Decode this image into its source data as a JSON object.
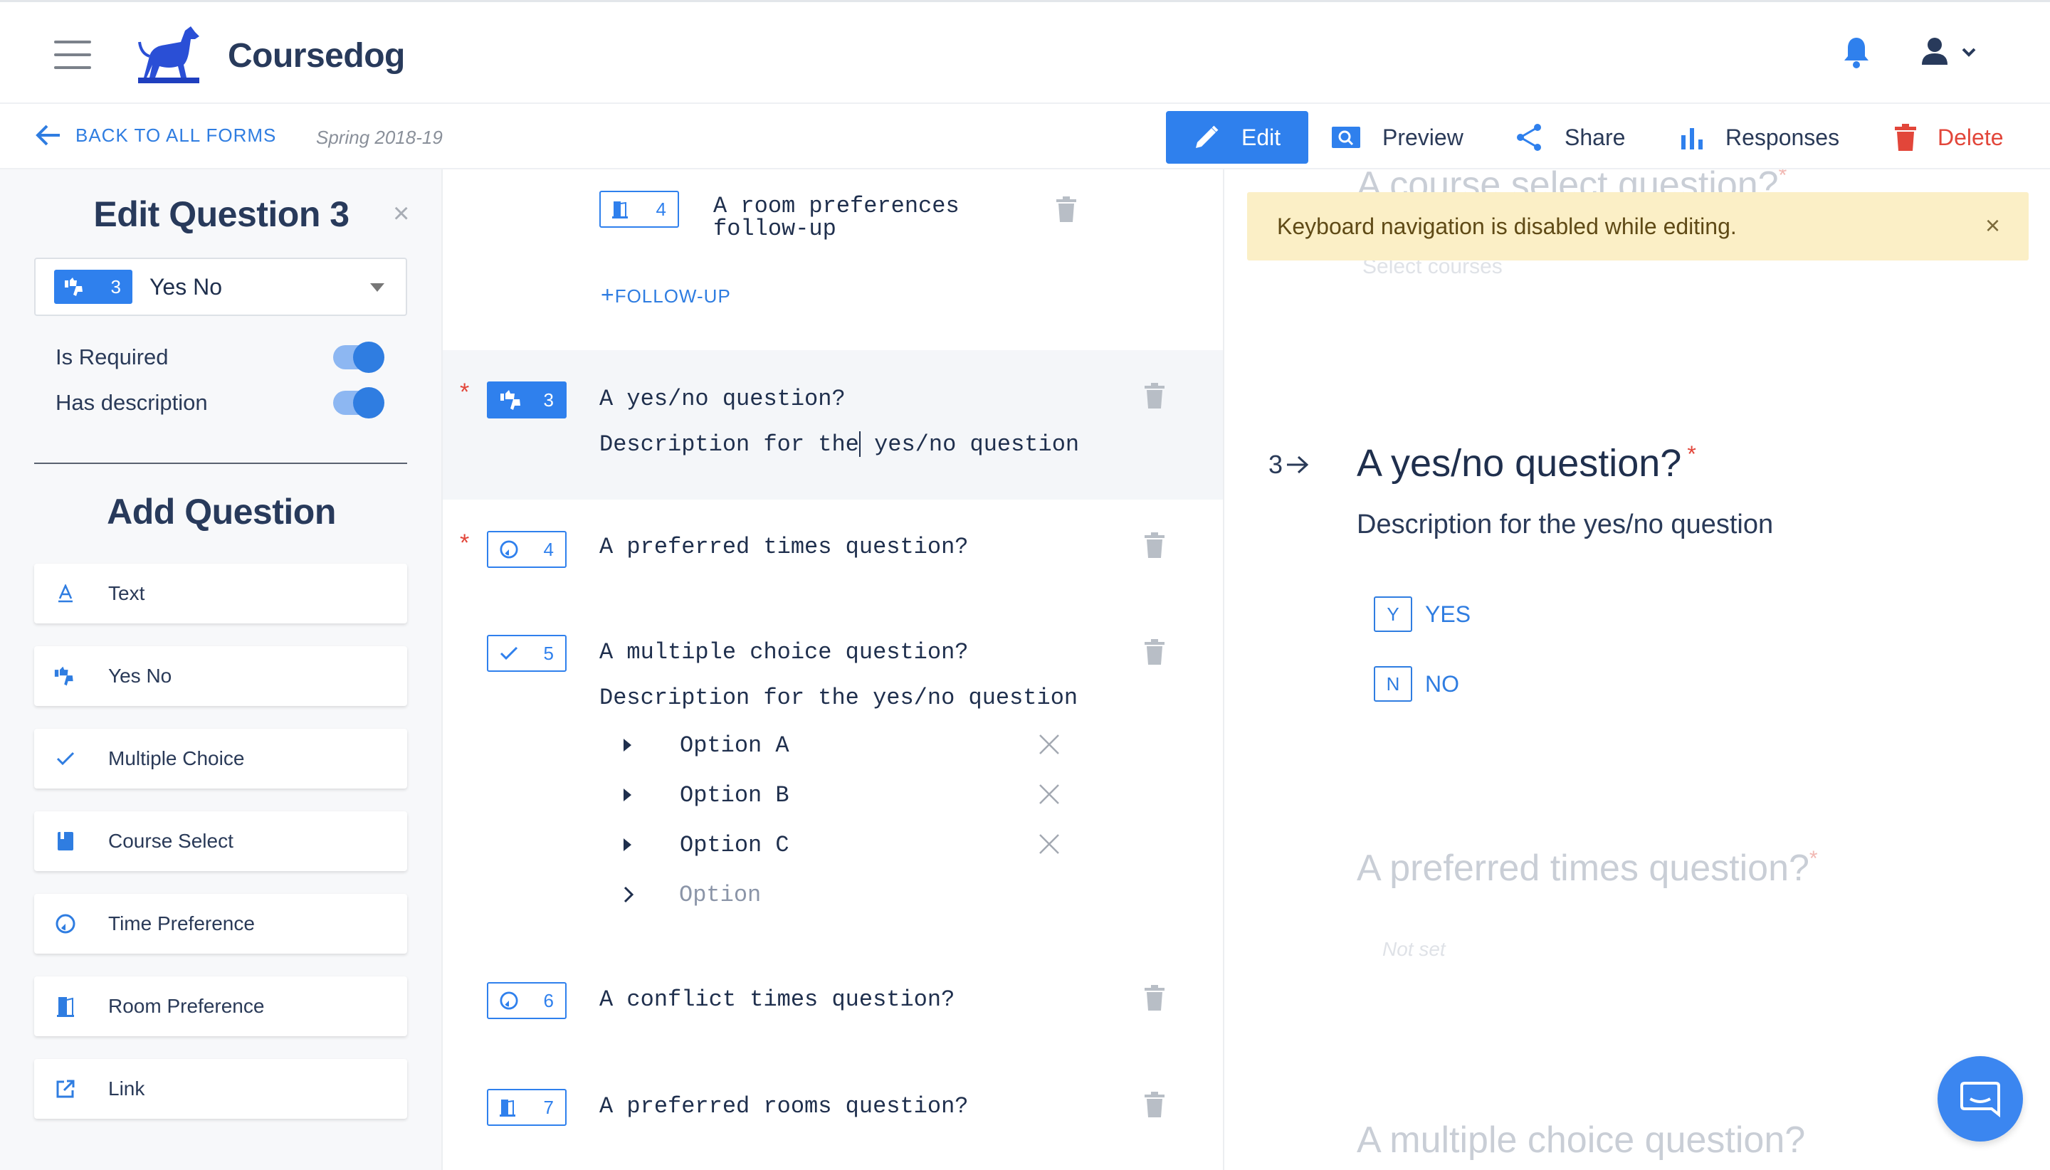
{
  "app": {
    "brand": "Coursedog"
  },
  "subbar": {
    "back_label": "BACK TO ALL FORMS",
    "term": "Spring 2018-19",
    "actions": {
      "edit": "Edit",
      "preview": "Preview",
      "share": "Share",
      "responses": "Responses",
      "delete": "Delete"
    }
  },
  "sidebar": {
    "edit_title": "Edit Question 3",
    "close_glyph": "×",
    "selected_type": {
      "number": "3",
      "label": "Yes No",
      "icon": "thumbs-icon"
    },
    "toggles": [
      {
        "label": "Is Required",
        "on": true
      },
      {
        "label": "Has description",
        "on": true
      }
    ],
    "add_title": "Add Question",
    "add_items": [
      {
        "label": "Text",
        "icon": "text-icon"
      },
      {
        "label": "Yes No",
        "icon": "thumbs-icon"
      },
      {
        "label": "Multiple Choice",
        "icon": "check-icon"
      },
      {
        "label": "Course Select",
        "icon": "book-icon"
      },
      {
        "label": "Time Preference",
        "icon": "clock-icon"
      },
      {
        "label": "Room Preference",
        "icon": "door-icon"
      },
      {
        "label": "Link",
        "icon": "external-link-icon"
      }
    ]
  },
  "questions": {
    "followup_q": {
      "number": "4",
      "line1": "A room preferences",
      "line2": "follow-up",
      "add_followup": "FOLLOW-UP"
    },
    "q3": {
      "number": "3",
      "required": "*",
      "title": "A yes/no question?",
      "desc_a": "Description for the",
      "desc_b": " yes/no question"
    },
    "q4": {
      "number": "4",
      "required": "*",
      "title": "A preferred times question?"
    },
    "q5": {
      "number": "5",
      "title": "A multiple choice question?",
      "desc": "Description for the yes/no question",
      "options": [
        "Option A",
        "Option B",
        "Option C"
      ],
      "new_option_placeholder": "Option"
    },
    "q6": {
      "number": "6",
      "title": "A conflict times question?"
    },
    "q7": {
      "number": "7",
      "title": "A preferred rooms question?"
    }
  },
  "preview": {
    "ghost_top_title": "A course select question?",
    "ghost_top_placeholder": "Select courses",
    "toast": "Keyboard navigation is disabled while editing.",
    "toast_close": "×",
    "active": {
      "number": "3",
      "title": "A yes/no question?",
      "required": "*",
      "desc": "Description for the yes/no question",
      "choices": [
        {
          "key": "Y",
          "label": "YES"
        },
        {
          "key": "N",
          "label": "NO"
        }
      ]
    },
    "ghost_mid_title": "A preferred times question?",
    "ghost_mid_value": "Not set",
    "ghost_bottom_title": "A multiple choice question?",
    "ghost_star": "*"
  },
  "colors": {
    "accent": "#2f80ed",
    "danger": "#e2463a",
    "toast_bg": "#fbefc6"
  }
}
